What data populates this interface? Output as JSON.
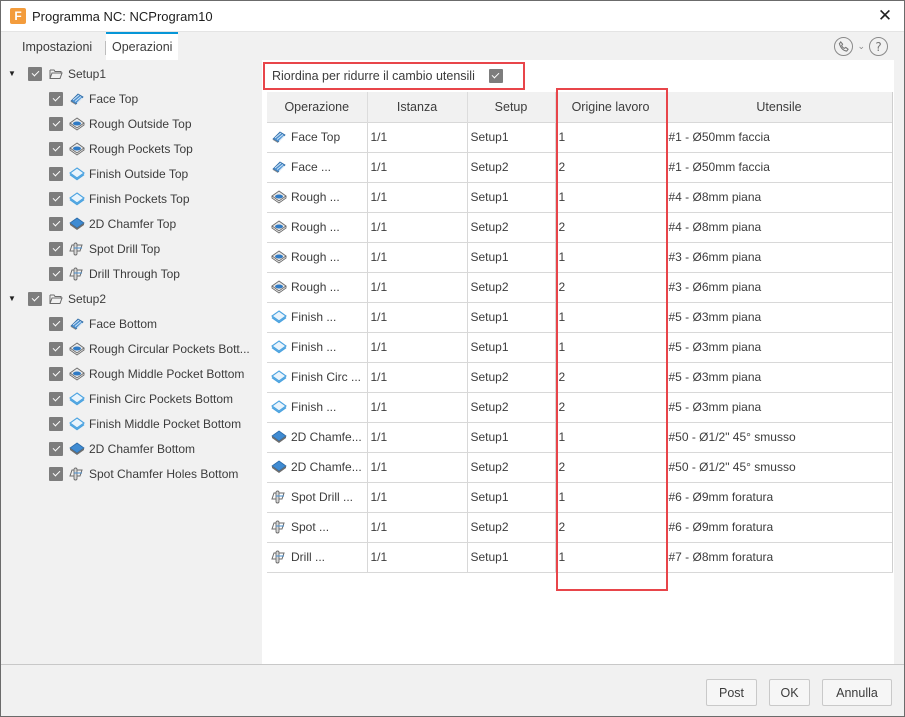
{
  "window": {
    "title": "Programma NC: NCProgram10",
    "app_icon_letter": "F",
    "close_icon": "close-icon"
  },
  "tabs": [
    {
      "label": "Impostazioni",
      "active": false
    },
    {
      "label": "Operazioni",
      "active": true
    }
  ],
  "help": {
    "contact_icon": "phone-icon",
    "dropdown_icon": "chevron-down-icon",
    "help_icon": "question-icon"
  },
  "tree": [
    {
      "type": "setup",
      "label": "Setup1",
      "checked": true,
      "expanded": true
    },
    {
      "type": "op",
      "icon": "face",
      "label": "Face Top",
      "checked": true
    },
    {
      "type": "op",
      "icon": "rough",
      "label": "Rough Outside Top",
      "checked": true
    },
    {
      "type": "op",
      "icon": "rough",
      "label": "Rough Pockets Top",
      "checked": true
    },
    {
      "type": "op",
      "icon": "finish",
      "label": "Finish Outside Top",
      "checked": true
    },
    {
      "type": "op",
      "icon": "finish",
      "label": "Finish Pockets Top",
      "checked": true
    },
    {
      "type": "op",
      "icon": "chamfer",
      "label": "2D Chamfer Top",
      "checked": true
    },
    {
      "type": "op",
      "icon": "drill",
      "label": "Spot Drill Top",
      "checked": true
    },
    {
      "type": "op",
      "icon": "drill",
      "label": "Drill Through Top",
      "checked": true
    },
    {
      "type": "setup",
      "label": "Setup2",
      "checked": true,
      "expanded": true
    },
    {
      "type": "op",
      "icon": "face",
      "label": "Face Bottom",
      "checked": true
    },
    {
      "type": "op",
      "icon": "rough",
      "label": "Rough Circular Pockets Bott...",
      "checked": true
    },
    {
      "type": "op",
      "icon": "rough",
      "label": "Rough Middle Pocket Bottom",
      "checked": true
    },
    {
      "type": "op",
      "icon": "finish",
      "label": "Finish Circ Pockets Bottom",
      "checked": true
    },
    {
      "type": "op",
      "icon": "finish",
      "label": "Finish Middle Pocket Bottom",
      "checked": true
    },
    {
      "type": "op",
      "icon": "chamfer",
      "label": "2D Chamfer Bottom",
      "checked": true
    },
    {
      "type": "op",
      "icon": "drill",
      "label": "Spot Chamfer Holes Bottom",
      "checked": true
    }
  ],
  "reorder": {
    "label": "Riordina per ridurre il cambio utensili",
    "checked": true
  },
  "table": {
    "headers": [
      "Operazione",
      "Istanza",
      "Setup",
      "Origine lavoro",
      "Utensile"
    ],
    "rows": [
      {
        "icon": "face",
        "op": "Face Top",
        "instance": "1/1",
        "setup": "Setup1",
        "origin": "1",
        "tool": "#1 - Ø50mm faccia"
      },
      {
        "icon": "face",
        "op": "Face ...",
        "instance": "1/1",
        "setup": "Setup2",
        "origin": "2",
        "tool": "#1 - Ø50mm faccia"
      },
      {
        "icon": "rough",
        "op": "Rough ...",
        "instance": "1/1",
        "setup": "Setup1",
        "origin": "1",
        "tool": "#4 - Ø8mm piana"
      },
      {
        "icon": "rough",
        "op": "Rough ...",
        "instance": "1/1",
        "setup": "Setup2",
        "origin": "2",
        "tool": "#4 - Ø8mm piana"
      },
      {
        "icon": "rough",
        "op": "Rough ...",
        "instance": "1/1",
        "setup": "Setup1",
        "origin": "1",
        "tool": "#3 - Ø6mm piana"
      },
      {
        "icon": "rough",
        "op": "Rough ...",
        "instance": "1/1",
        "setup": "Setup2",
        "origin": "2",
        "tool": "#3 - Ø6mm piana"
      },
      {
        "icon": "finish",
        "op": "Finish ...",
        "instance": "1/1",
        "setup": "Setup1",
        "origin": "1",
        "tool": "#5 - Ø3mm piana"
      },
      {
        "icon": "finish",
        "op": "Finish ...",
        "instance": "1/1",
        "setup": "Setup1",
        "origin": "1",
        "tool": "#5 - Ø3mm piana"
      },
      {
        "icon": "finish",
        "op": "Finish Circ ...",
        "instance": "1/1",
        "setup": "Setup2",
        "origin": "2",
        "tool": "#5 - Ø3mm piana"
      },
      {
        "icon": "finish",
        "op": "Finish ...",
        "instance": "1/1",
        "setup": "Setup2",
        "origin": "2",
        "tool": "#5 - Ø3mm piana"
      },
      {
        "icon": "chamfer",
        "op": "2D Chamfe...",
        "instance": "1/1",
        "setup": "Setup1",
        "origin": "1",
        "tool": "#50 - Ø1/2\" 45° smusso"
      },
      {
        "icon": "chamfer",
        "op": "2D Chamfe...",
        "instance": "1/1",
        "setup": "Setup2",
        "origin": "2",
        "tool": "#50 - Ø1/2\" 45° smusso"
      },
      {
        "icon": "drill",
        "op": "Spot Drill ...",
        "instance": "1/1",
        "setup": "Setup1",
        "origin": "1",
        "tool": "#6 - Ø9mm foratura"
      },
      {
        "icon": "drill",
        "op": "Spot ...",
        "instance": "1/1",
        "setup": "Setup2",
        "origin": "2",
        "tool": "#6 - Ø9mm foratura"
      },
      {
        "icon": "drill",
        "op": "Drill ...",
        "instance": "1/1",
        "setup": "Setup1",
        "origin": "1",
        "tool": "#7 - Ø8mm foratura"
      }
    ]
  },
  "footer": {
    "post_label": "Post",
    "ok_label": "OK",
    "cancel_label": "Annulla"
  },
  "colors": {
    "accent": "#0696d7",
    "highlight": "#e8454a",
    "app_icon": "#f39c3c"
  }
}
